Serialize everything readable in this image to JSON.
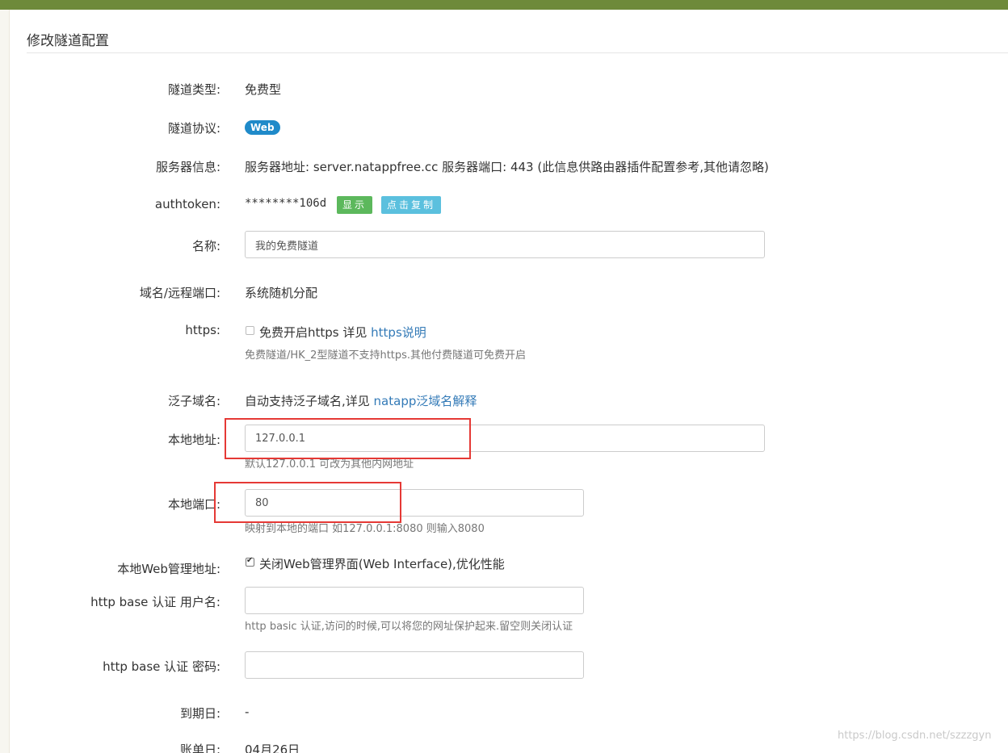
{
  "title": "修改隧道配置",
  "fields": {
    "type": {
      "label": "隧道类型:",
      "value": "免费型"
    },
    "protocol": {
      "label": "隧道协议:",
      "badge": "Web"
    },
    "server": {
      "label": "服务器信息:",
      "value": "服务器地址: server.natappfree.cc 服务器端口: 443 (此信息供路由器插件配置参考,其他请忽略)"
    },
    "authtoken": {
      "label": "authtoken:",
      "value": "********106d",
      "show_button": "显示",
      "copy_button": "点击复制"
    },
    "name": {
      "label": "名称:",
      "value": "我的免费隧道"
    },
    "domain": {
      "label": "域名/远程端口:",
      "value": "系统随机分配"
    },
    "https": {
      "label": "https:",
      "checkbox_text": "免费开启https 详见 ",
      "link": "https说明",
      "help": "免费隧道/HK_2型隧道不支持https.其他付费隧道可免费开启"
    },
    "wildcard": {
      "label": "泛子域名:",
      "text": "自动支持泛子域名,详见 ",
      "link": "natapp泛域名解释"
    },
    "local_addr": {
      "label": "本地地址:",
      "value": "127.0.0.1",
      "help": "默认127.0.0.1 可改为其他内网地址"
    },
    "local_port": {
      "label": "本地端口:",
      "value": "80",
      "help": "映射到本地的端口 如127.0.0.1:8080 则输入8080"
    },
    "web_mgmt": {
      "label": "本地Web管理地址:",
      "checkbox_text": "关闭Web管理界面(Web Interface),优化性能"
    },
    "auth_user": {
      "label": "http base 认证 用户名:",
      "value": "",
      "help": "http basic 认证,访问的时候,可以将您的网址保护起来.留空则关闭认证"
    },
    "auth_pass": {
      "label": "http base 认证 密码:",
      "value": ""
    },
    "expire": {
      "label": "到期日:",
      "value": "-"
    },
    "bill": {
      "label": "账单日:",
      "value": "04月26日"
    }
  },
  "watermark": "https://blog.csdn.net/szzzgyn"
}
